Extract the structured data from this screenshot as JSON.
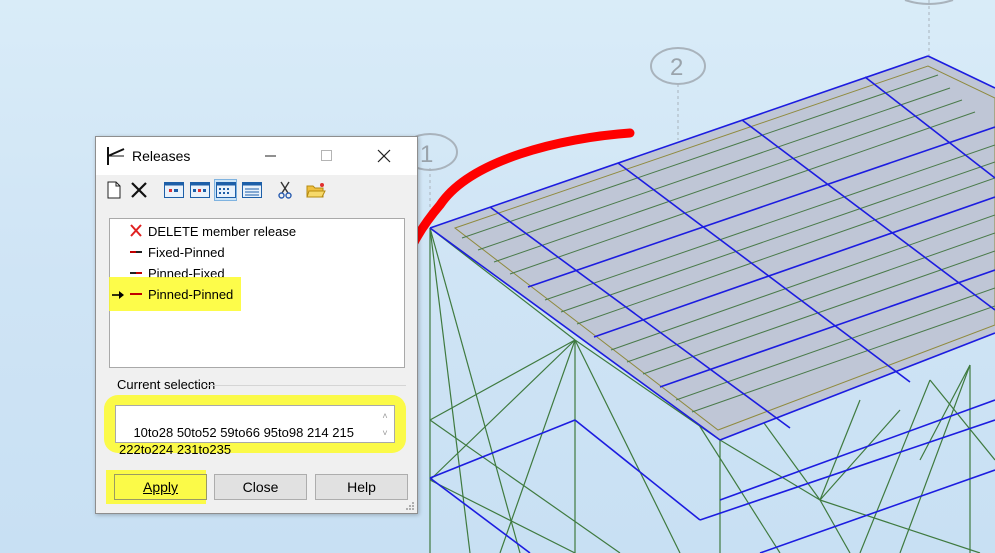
{
  "scene": {
    "axis_bubbles": [
      "2",
      "1"
    ],
    "colors": {
      "slab_fill": "#bfc6d6",
      "beam": "#1c1ce0",
      "brace": "#3f7a3f",
      "annotation": "#ff0000",
      "highlight": "#fdfc2a"
    }
  },
  "dialog": {
    "title": "Releases",
    "titlebar_buttons": {
      "minimize": "minimize-icon",
      "maximize": "maximize-icon",
      "close": "close-icon"
    },
    "toolbar": [
      "new-icon",
      "delete-icon",
      "view-1-icon",
      "view-2-icon",
      "view-3-icon",
      "view-4-icon",
      "cut-icon",
      "open-folder-icon"
    ],
    "list": {
      "items": [
        {
          "label": "DELETE member release",
          "icon": "red-x-icon",
          "selected": false
        },
        {
          "label": "Fixed-Pinned",
          "icon": "release-symbol-icon",
          "selected": false
        },
        {
          "label": "Pinned-Fixed",
          "icon": "release-symbol-icon",
          "selected": false
        },
        {
          "label": "Pinned-Pinned",
          "icon": "release-symbol-icon",
          "selected": true
        }
      ]
    },
    "current_selection": {
      "label": "Current selection",
      "value": "10to28 50to52 59to66 95to98 214 215\n222to224 231to235"
    },
    "buttons": {
      "apply": "Apply",
      "close": "Close",
      "help": "Help"
    }
  }
}
